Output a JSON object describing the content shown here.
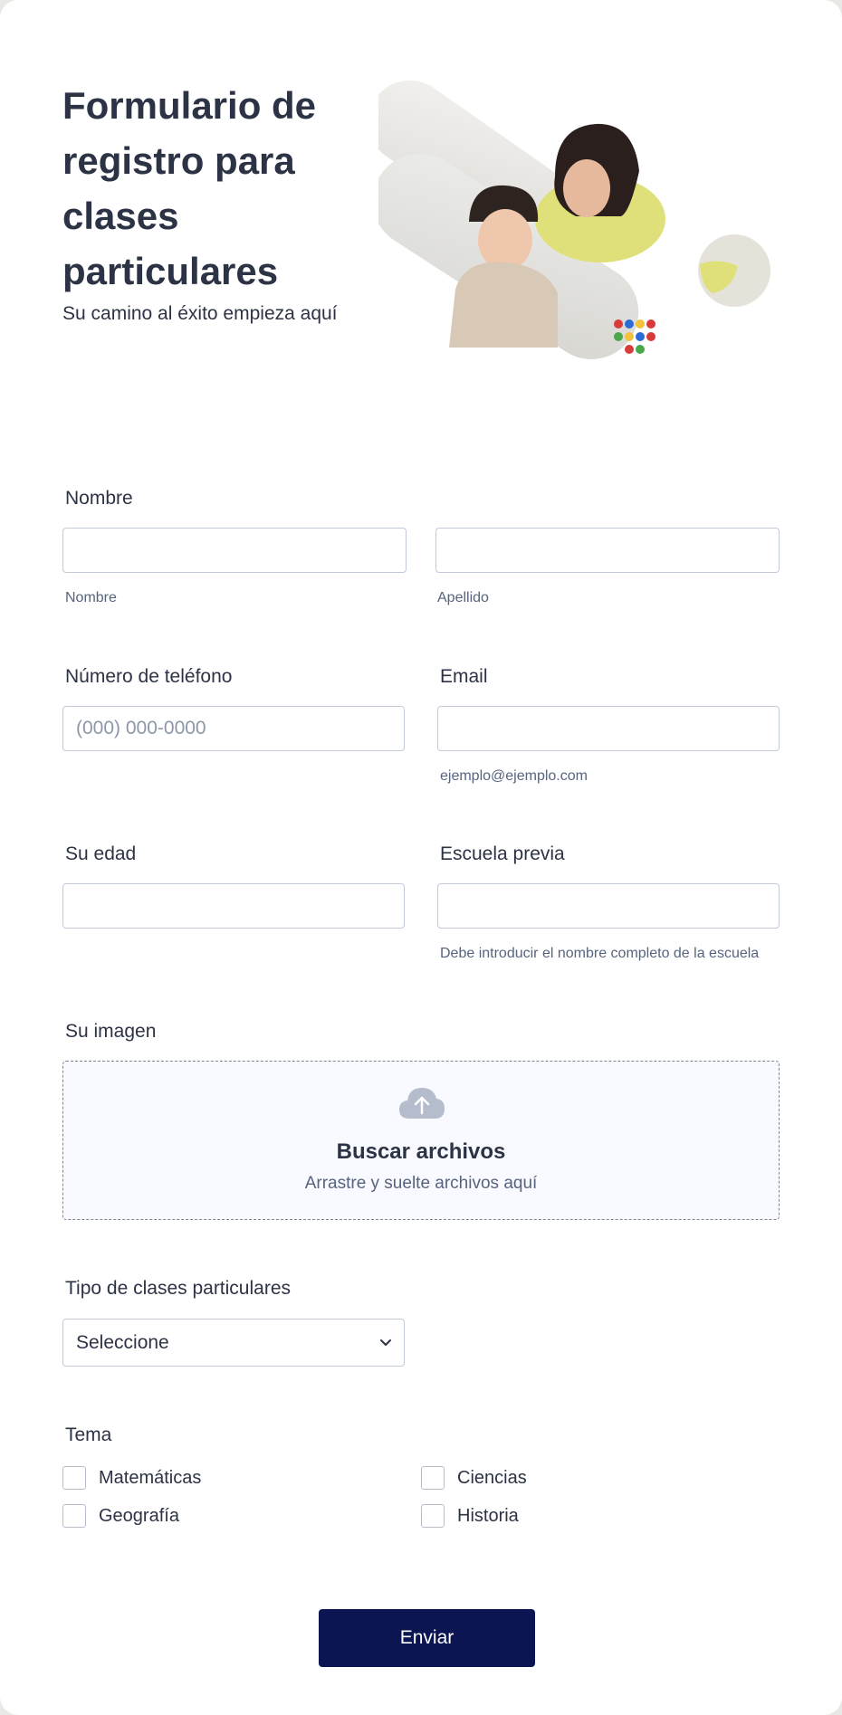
{
  "header": {
    "title": "Formulario de registro para clases particulares",
    "subtitle": "Su camino al éxito empieza aquí"
  },
  "fields": {
    "name": {
      "label": "Nombre",
      "first_sublabel": "Nombre",
      "last_sublabel": "Apellido"
    },
    "phone": {
      "label": "Número de teléfono",
      "placeholder": "(000) 000-0000"
    },
    "email": {
      "label": "Email",
      "sublabel": "ejemplo@ejemplo.com"
    },
    "age": {
      "label": "Su edad"
    },
    "school": {
      "label": "Escuela previa",
      "sublabel": "Debe introducir el nombre completo de la escuela"
    },
    "image": {
      "label": "Su imagen",
      "upload_title": "Buscar archivos",
      "upload_subtitle": "Arrastre y suelte archivos aquí",
      "icon": "cloud-upload-icon"
    },
    "tutoring_type": {
      "label": "Tipo de clases particulares",
      "selected": "Seleccione",
      "icon": "chevron-down-icon"
    },
    "subject": {
      "label": "Tema",
      "options": [
        "Matemáticas",
        "Ciencias",
        "Geografía",
        "Historia"
      ]
    }
  },
  "submit_label": "Enviar",
  "colors": {
    "text": "#2c3345",
    "border": "#c3cad8",
    "submit_bg": "#0a1551",
    "upload_bg": "#f9faff"
  }
}
